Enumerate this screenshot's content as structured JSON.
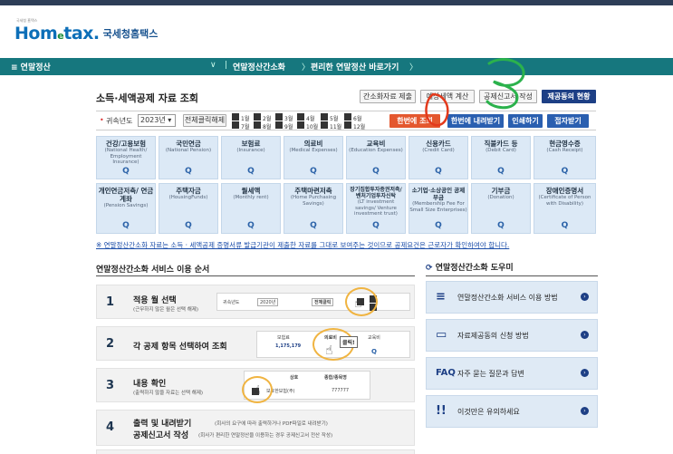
{
  "header": {
    "logo_small": "국세청 홈택스",
    "logo_home": "Hom",
    "logo_e": "e",
    "logo_tax": "tax.",
    "logo_korean": "국세청홈택스"
  },
  "nav": {
    "menu_label": "≡ 연말정산",
    "chevron": "∨",
    "crumbs": [
      "연말정산간소화",
      "편리한 연말정산 바로가기"
    ]
  },
  "page": {
    "title": "소득·세액공제 자료 조회",
    "toolbar": {
      "btn1": "간소화자료 제출",
      "btn2": "예상세액 계산",
      "btn3": "공제신고서 작성",
      "btn4": "제공동의 현황"
    }
  },
  "filter": {
    "year_label": "귀속년도",
    "year_value": "2023년",
    "select_all": "전체클릭해제",
    "months": [
      "1월",
      "2월",
      "3월",
      "4월",
      "5월",
      "6월",
      "7월",
      "8월",
      "9월",
      "10월",
      "11월",
      "12월"
    ],
    "btn_view_all": "한번에 조회",
    "btn_download_all": "한번에 내려받기",
    "btn_print": "인쇄하기",
    "btn_close": "접자받기"
  },
  "categories": [
    {
      "name": "건강/고용보험",
      "en": "(National Health/ Employment Insurance)"
    },
    {
      "name": "국민연금",
      "en": "(National Pension)"
    },
    {
      "name": "보험료",
      "en": "(Insurance)"
    },
    {
      "name": "의료비",
      "en": "(Medical Expenses)"
    },
    {
      "name": "교육비",
      "en": "(Education Expenses)"
    },
    {
      "name": "신용카드",
      "en": "(Credit Card)"
    },
    {
      "name": "직불카드 등",
      "en": "(Debit Card)"
    },
    {
      "name": "현금영수증",
      "en": "(Cash Receipt)"
    },
    {
      "name": "개인연금저축/ 연금계좌",
      "en": "(Pension Savings)"
    },
    {
      "name": "주택자금",
      "en": "(HousingFunds)"
    },
    {
      "name": "월세액",
      "en": "(Monthly rent)"
    },
    {
      "name": "주택마련저축",
      "en": "(Home Purchasing Savings)"
    },
    {
      "name": "장기집합투자증권저축/ 벤처기업투자신탁",
      "en": "(LT investment savings/ Venture investment trust)"
    },
    {
      "name": "소기업·소상공인 공제부금",
      "en": "(Membership Fee For Small Size Enterprises)"
    },
    {
      "name": "기부금",
      "en": "(Donation)"
    },
    {
      "name": "장애인증명서",
      "en": "(Certificate of Person with Disability)"
    }
  ],
  "notice": "※ 연말정산간소화 자료는 소득 · 세액공제 증명서류 발급기관이 제출한 자료를 그대로 보여주는 것이므로 공제요건은 근로자가 확인하여야 합니다.",
  "order": {
    "title": "연말정산간소화 서비스 이용 순서",
    "steps": [
      {
        "num": "1",
        "title": "적용 월 선택",
        "desc": "(근무하지 않은 월은 선택 해제)"
      },
      {
        "num": "2",
        "title": "각 공제 항목 선택하여 조회",
        "desc": ""
      },
      {
        "num": "3",
        "title": "내용 확인",
        "desc": "(출력하지 않을 자료는 선택 해제)"
      },
      {
        "num": "4",
        "title": "출력 및 내려받기",
        "desc": "(회사의 요구에 따라 출력하거나 PDF파일로 내려받기)",
        "title2": "공제신고서 작성",
        "desc2": "(회사가 편리한 연말정산을 이용하는 경우 공제신고서 전산 작성)"
      }
    ],
    "mini1": {
      "year_label": "귀속년도",
      "year": "2020년",
      "select_all": "전체클릭"
    },
    "mini2": {
      "c1": "보험료",
      "c2": "의료비",
      "c3": "교육비",
      "amount": "1,175,179",
      "bubble": "클릭!"
    },
    "mini3": {
      "h1": "상호",
      "h2": "종합/종목명",
      "row": "보호한보험(주)",
      "val": "777777"
    }
  },
  "help": {
    "title": "연말정산간소화 도우미",
    "items": [
      {
        "icon": "≡",
        "label": "연말정산간소화 서비스 이용 방법"
      },
      {
        "icon": "▭",
        "label": "자료제공동의 신청 방법"
      },
      {
        "icon": "FAQ",
        "label": "자주 묻는 질문과 답변"
      },
      {
        "icon": "!!",
        "label": "이것만은 유의하세요"
      }
    ]
  },
  "colors": {
    "navbar": "#16777e",
    "navy": "#1d3f85",
    "orange": "#e4572e",
    "tile": "#dce9f6",
    "annotation_green": "#2bb24c",
    "highlight": "#f0b441"
  }
}
